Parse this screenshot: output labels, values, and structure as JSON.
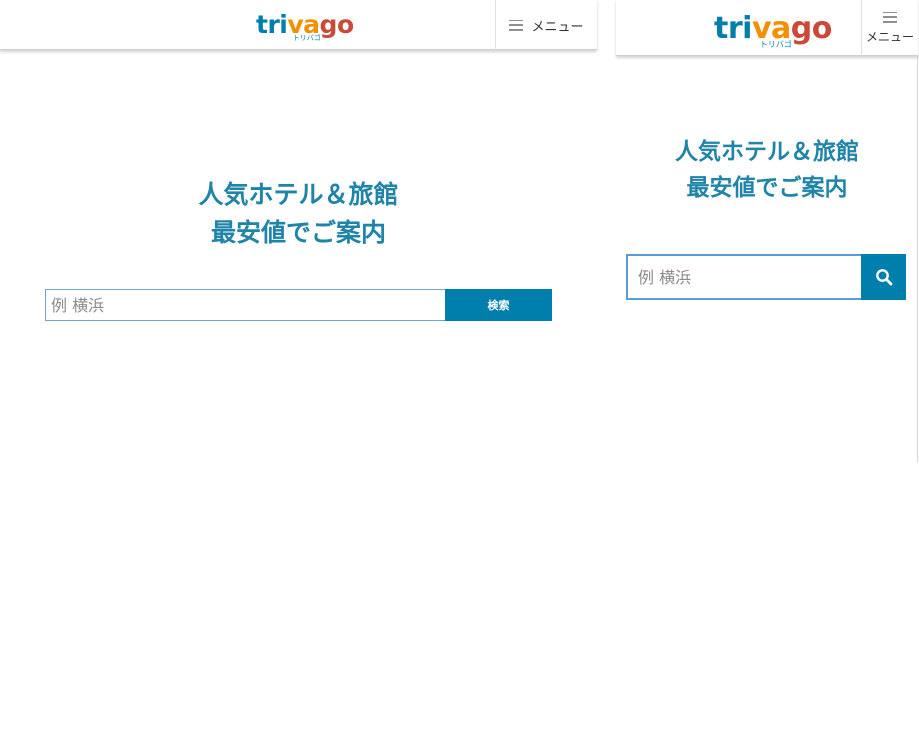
{
  "brand": {
    "logo_letters": [
      {
        "char": "t",
        "color": "#007fad"
      },
      {
        "char": "r",
        "color": "#007fad"
      },
      {
        "char": "i",
        "color": "#007fad"
      },
      {
        "char": "v",
        "color": "#f48f00"
      },
      {
        "char": "a",
        "color": "#f48f00"
      },
      {
        "char": "g",
        "color": "#c94a38"
      },
      {
        "char": "o",
        "color": "#c94a38"
      }
    ],
    "logo_sub": "トリバゴ"
  },
  "desktop": {
    "menu_label": "メニュー",
    "hero_line1": "人気ホテル＆旅館",
    "hero_line2": "最安値でご案内",
    "search": {
      "placeholder": "例 横浜",
      "value": "",
      "button_label": "検索"
    }
  },
  "mobile": {
    "menu_label": "メニュー",
    "hero_line1": "人気ホテル＆旅館",
    "hero_line2": "最安値でご案内",
    "search": {
      "placeholder": "例 横浜",
      "value": "",
      "button_icon": "magnifier-icon"
    }
  },
  "colors": {
    "accent": "#007fad",
    "hero_text": "#1f84a8",
    "input_border": "#6da6cf"
  }
}
